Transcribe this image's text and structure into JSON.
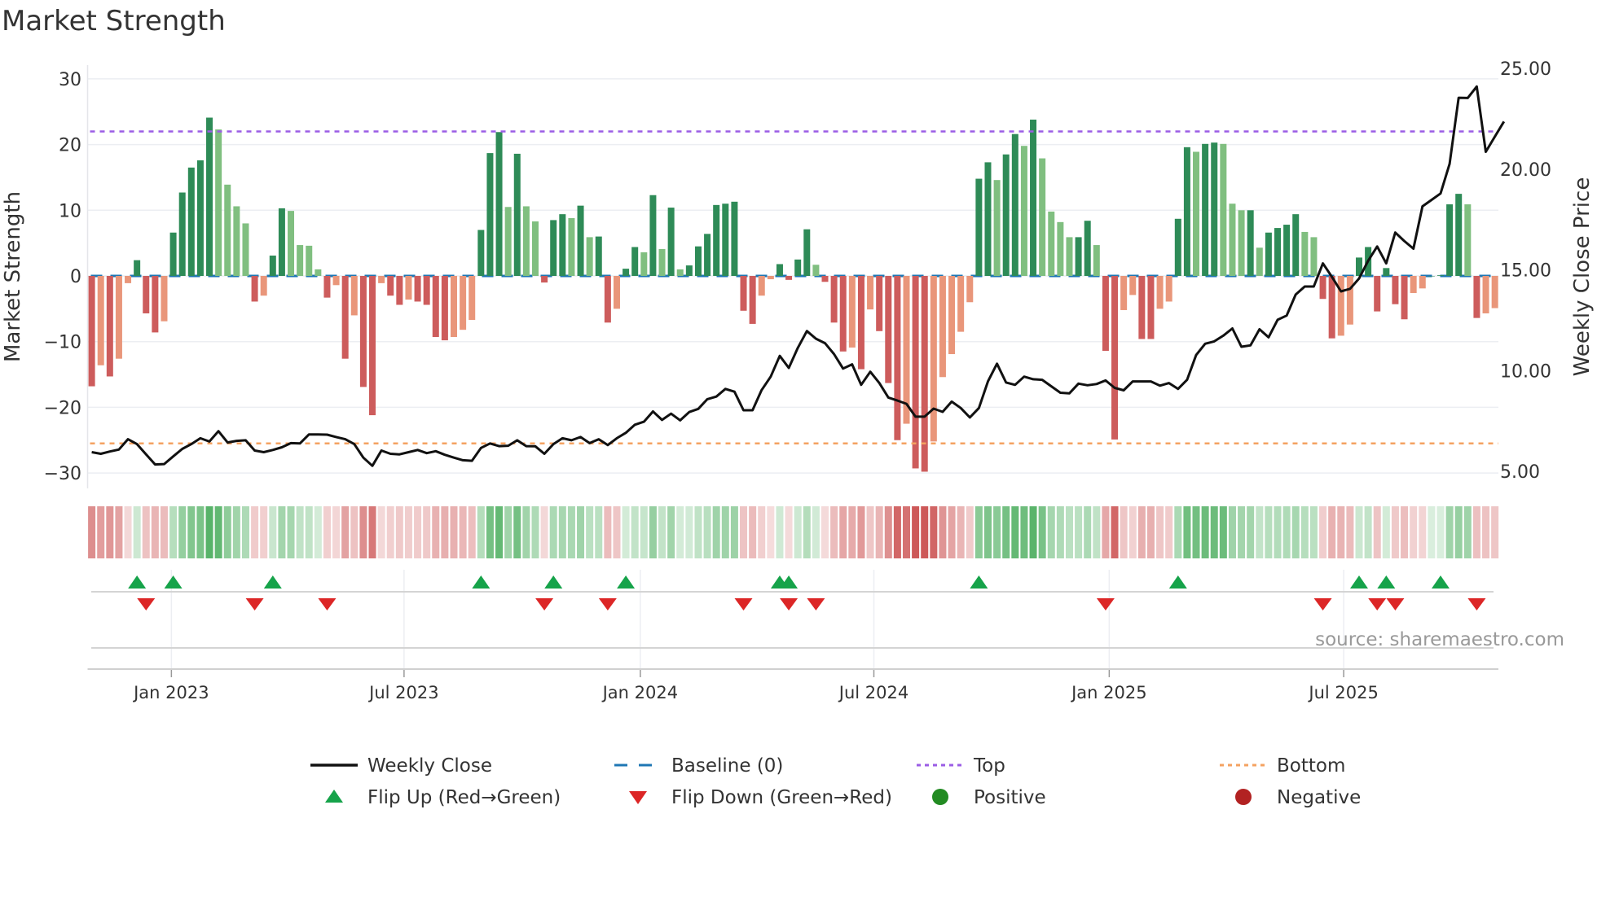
{
  "title": "Market Strength",
  "source": "source: sharemaestro.com",
  "chart_data": {
    "type": "bar",
    "title": "Market Strength",
    "ylabel": "Market Strength",
    "y2label": "Weekly Close Price",
    "ylim": [
      -32,
      32
    ],
    "y2lim": [
      5,
      25
    ],
    "yticks": [
      "30",
      "20",
      "10",
      "0",
      "−10",
      "−20",
      "−30"
    ],
    "ytick_values": [
      30,
      20,
      10,
      0,
      -10,
      -20,
      -30
    ],
    "y2ticks": [
      "25.00",
      "20.00",
      "15.00",
      "10.00",
      "5.00"
    ],
    "y2tick_values": [
      25,
      20,
      15,
      10,
      5
    ],
    "xticks": [
      {
        "label": "Jan 2023",
        "week": 8.8
      },
      {
        "label": "Jul 2023",
        "week": 34.5
      },
      {
        "label": "Jan 2024",
        "week": 60.6
      },
      {
        "label": "Jul 2024",
        "week": 86.4
      },
      {
        "label": "Jan 2025",
        "week": 112.4
      },
      {
        "label": "Jul 2025",
        "week": 138.3
      }
    ],
    "top_level": 22,
    "bottom_level": -25.5,
    "strength": [
      -16.8,
      -13.6,
      -15.3,
      -12.6,
      -1.1,
      2.4,
      -5.7,
      -8.6,
      -6.9,
      6.6,
      12.7,
      16.5,
      17.6,
      24.1,
      22.3,
      13.9,
      10.6,
      8.0,
      -3.9,
      -3.0,
      3.1,
      10.3,
      9.9,
      4.7,
      4.6,
      1.0,
      -3.3,
      -1.4,
      -12.6,
      -6.0,
      -16.9,
      -21.2,
      -1.1,
      -3.0,
      -4.4,
      -3.6,
      -3.9,
      -4.4,
      -9.3,
      -9.8,
      -9.3,
      -8.2,
      -6.7,
      7.0,
      18.7,
      21.9,
      10.5,
      18.6,
      10.6,
      8.3,
      -1.0,
      8.5,
      9.4,
      8.8,
      10.7,
      5.9,
      6.0,
      -7.1,
      -5.0,
      1.1,
      4.4,
      3.6,
      12.3,
      4.1,
      10.4,
      1.0,
      1.6,
      4.5,
      6.4,
      10.8,
      11.0,
      11.3,
      -5.3,
      -7.3,
      -3.0,
      -0.5,
      1.8,
      -0.6,
      2.5,
      7.1,
      1.7,
      -0.9,
      -7.1,
      -11.5,
      -10.9,
      -14.2,
      -5.1,
      -8.4,
      -16.3,
      -25.0,
      -22.5,
      -29.3,
      -29.8,
      -25.2,
      -15.4,
      -11.9,
      -8.5,
      -4.0,
      14.8,
      17.3,
      14.6,
      18.5,
      21.6,
      19.8,
      23.8,
      17.9,
      9.8,
      8.2,
      5.9,
      5.9,
      8.4,
      4.7,
      -11.4,
      -24.9,
      -5.2,
      -2.9,
      -9.6,
      -9.6,
      -5.0,
      -3.9,
      8.7,
      19.6,
      18.9,
      20.1,
      20.3,
      20.1,
      11.0,
      10.0,
      10.0,
      4.3,
      6.6,
      7.3,
      7.8,
      9.4,
      6.7,
      5.9,
      -3.5,
      -9.5,
      -9.1,
      -7.4,
      2.8,
      4.4,
      -5.4,
      1.2,
      -4.3,
      -6.6,
      -2.6,
      -1.9,
      0,
      0.1,
      10.9,
      12.5,
      10.9,
      -6.4,
      -5.7,
      -4.9
    ],
    "weekly_close": [
      5.95,
      5.87,
      5.98,
      6.08,
      6.59,
      6.35,
      5.84,
      5.34,
      5.36,
      5.74,
      6.11,
      6.35,
      6.64,
      6.48,
      6.99,
      6.43,
      6.51,
      6.54,
      6.03,
      5.95,
      6.06,
      6.19,
      6.4,
      6.38,
      6.83,
      6.83,
      6.82,
      6.7,
      6.59,
      6.35,
      5.68,
      5.27,
      6.03,
      5.87,
      5.84,
      5.95,
      6.06,
      5.9,
      6.0,
      5.82,
      5.68,
      5.55,
      5.52,
      6.16,
      6.38,
      6.25,
      6.27,
      6.54,
      6.25,
      6.24,
      5.87,
      6.35,
      6.64,
      6.54,
      6.7,
      6.4,
      6.59,
      6.3,
      6.64,
      6.91,
      7.31,
      7.46,
      7.97,
      7.55,
      7.86,
      7.53,
      7.94,
      8.1,
      8.58,
      8.71,
      9.09,
      8.95,
      8.03,
      8.03,
      9.03,
      9.7,
      10.73,
      10.13,
      11.13,
      11.96,
      11.58,
      11.36,
      10.82,
      10.1,
      10.31,
      9.29,
      9.94,
      9.38,
      8.66,
      8.51,
      8.35,
      7.71,
      7.71,
      8.11,
      7.95,
      8.46,
      8.14,
      7.67,
      8.14,
      9.46,
      10.34,
      9.41,
      9.29,
      9.7,
      9.57,
      9.54,
      9.22,
      8.9,
      8.87,
      9.35,
      9.27,
      9.33,
      9.51,
      9.14,
      9.02,
      9.46,
      9.46,
      9.46,
      9.25,
      9.38,
      9.09,
      9.54,
      10.77,
      11.33,
      11.45,
      11.73,
      12.09,
      11.18,
      11.25,
      12.05,
      11.65,
      12.52,
      12.73,
      13.77,
      14.17,
      14.17,
      15.32,
      14.65,
      13.93,
      14.06,
      14.57,
      15.45,
      16.16,
      15.32,
      16.85,
      16.43,
      16.05,
      18.15,
      18.47,
      18.79,
      20.26,
      23.54,
      23.53,
      24.1,
      20.86,
      21.61,
      22.36
    ],
    "flip_up_weeks": [
      5,
      9,
      20,
      43,
      51,
      59,
      76,
      77,
      98,
      120,
      140,
      143,
      149
    ],
    "flip_down_weeks": [
      6,
      18,
      26,
      50,
      57,
      72,
      77,
      80,
      112,
      136,
      142,
      144,
      153
    ],
    "legend": [
      {
        "label": "Weekly Close",
        "kind": "line",
        "color": "#111111"
      },
      {
        "label": "Baseline (0)",
        "kind": "dash",
        "color": "#1f77b4"
      },
      {
        "label": "Top",
        "kind": "dot",
        "color": "#9b5de5"
      },
      {
        "label": "Bottom",
        "kind": "dot",
        "color": "#f4a261"
      },
      {
        "label": "Flip Up (Red→Green)",
        "kind": "up",
        "color": "#16a34a"
      },
      {
        "label": "Flip Down (Green→Red)",
        "kind": "down",
        "color": "#dc2626"
      },
      {
        "label": "Positive",
        "kind": "circle",
        "color": "#228b22"
      },
      {
        "label": "Negative",
        "kind": "circle",
        "color": "#b22222"
      }
    ],
    "legend_placement": "bottom",
    "colors": {
      "pos_strong": "#2e8b57",
      "pos_weak": "#80bf80",
      "neg_strong": "#cd5c5c",
      "neg_weak": "#e9967a",
      "baseline": "#1f77b4",
      "top": "#9b5de5",
      "bottom": "#f4a261",
      "grid": "#eceef2"
    }
  }
}
